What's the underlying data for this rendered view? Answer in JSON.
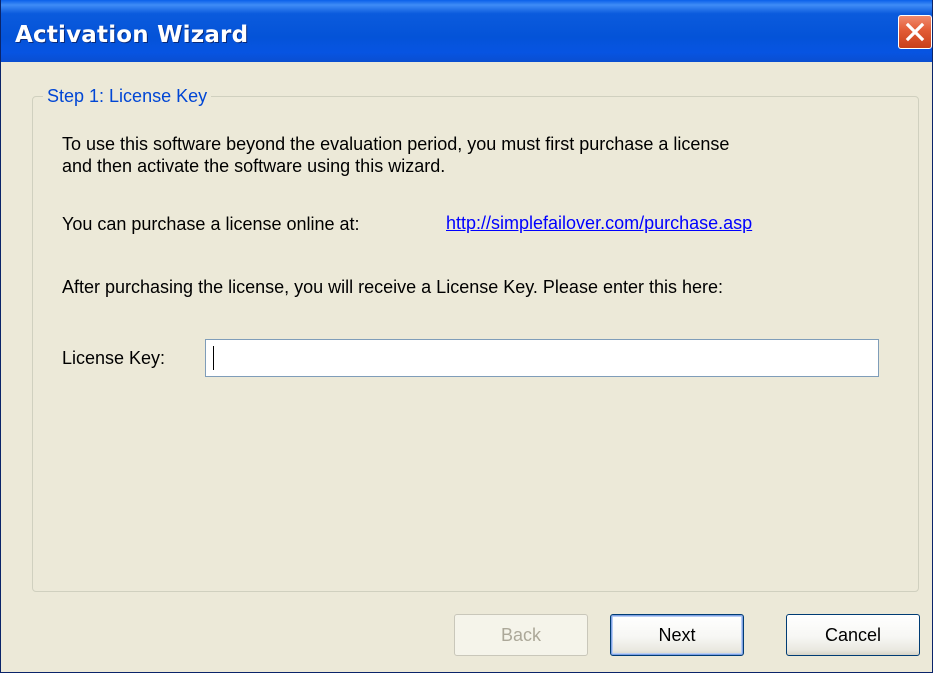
{
  "window": {
    "title": "Activation Wizard"
  },
  "step": {
    "title": "Step 1: License Key",
    "intro_line1": "To use this software beyond the evaluation period, you must first purchase a license",
    "intro_line2": "and then activate the software using this wizard.",
    "purchase_label": "You can purchase a license online at:",
    "purchase_url": "http://simplefailover.com/purchase.asp",
    "after_purchase": "After purchasing the license, you will receive a License Key. Please enter this here:",
    "license_key_label": "License Key:",
    "license_key_value": ""
  },
  "buttons": {
    "back": "Back",
    "next": "Next",
    "cancel": "Cancel"
  },
  "icons": {
    "close": "close-icon"
  },
  "colors": {
    "titlebar": "#0453D8",
    "face": "#ECE9D8",
    "group_title": "#0046D5",
    "link": "#0000FF",
    "close_button": "#E25B35"
  }
}
